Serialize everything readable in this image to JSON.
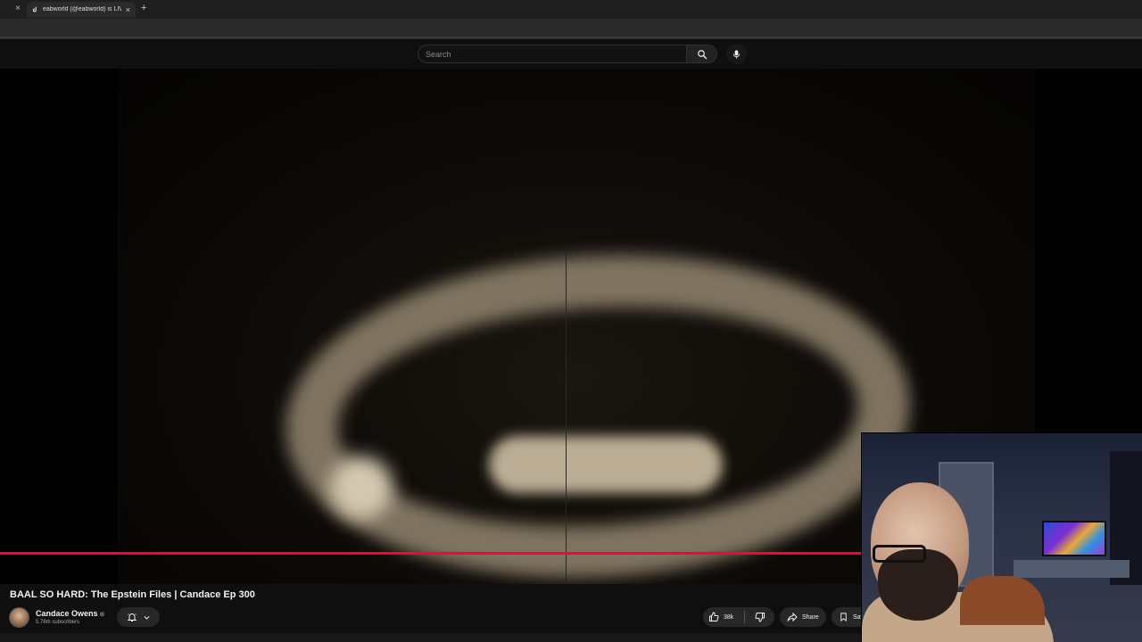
{
  "browser": {
    "tab": {
      "title": "eabworld (@eabworld) is LIVE",
      "close": "×"
    },
    "new_tab": "+",
    "prev_tab_close": "×"
  },
  "header": {
    "search": {
      "placeholder": "Search"
    },
    "icons": {
      "search": "search-icon",
      "mic": "microphone-icon"
    }
  },
  "video": {
    "progress_fraction": 0.755,
    "colors": {
      "progress": "#ff0033"
    }
  },
  "info": {
    "title": "BAAL SO HARD: The Epstein Files | Candace Ep 300",
    "channel": {
      "name": "Candace Owens",
      "verified": "⊙",
      "subscribers": "5.76m subscribers"
    },
    "actions": {
      "like_count": "38k",
      "share": "Share",
      "save": "Save"
    }
  }
}
